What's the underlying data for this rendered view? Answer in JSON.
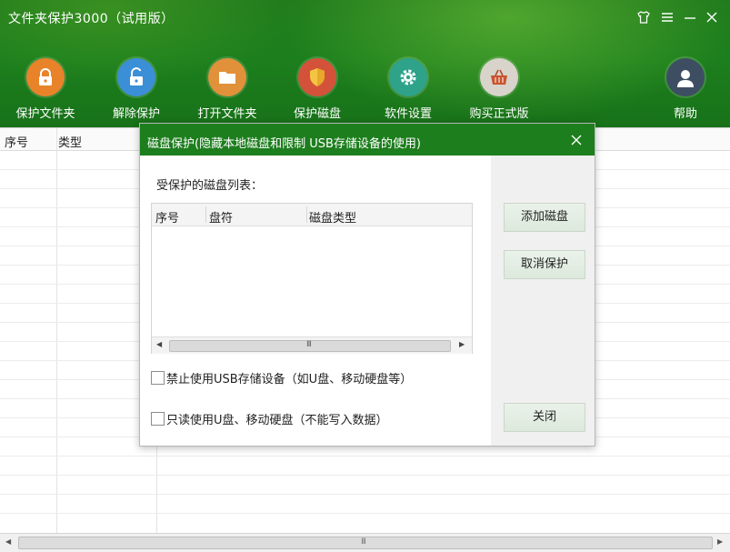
{
  "app": {
    "title": "文件夹保护3000（试用版）"
  },
  "window_controls": [
    {
      "name": "skin-icon"
    },
    {
      "name": "menu-icon"
    },
    {
      "name": "minimize-icon"
    },
    {
      "name": "close-icon"
    }
  ],
  "toolbar": {
    "items": [
      {
        "label": "保护文件夹",
        "icon": "lock-icon",
        "color": "#e8832a"
      },
      {
        "label": "解除保护",
        "icon": "unlock-icon",
        "color": "#3a8fd6"
      },
      {
        "label": "打开文件夹",
        "icon": "folder-icon",
        "color": "#e0913a"
      },
      {
        "label": "保护磁盘",
        "icon": "shield-icon",
        "color": "#d5523a"
      },
      {
        "label": "软件设置",
        "icon": "gear-icon",
        "color": "#2ea38a"
      },
      {
        "label": "购买正式版",
        "icon": "basket-icon",
        "color": "#d8d3cb"
      },
      {
        "label": "帮助",
        "icon": "user-icon",
        "color": "#3e4e62"
      }
    ]
  },
  "main_table": {
    "columns": [
      "序号",
      "类型"
    ]
  },
  "dialog": {
    "title": "磁盘保护(隐藏本地磁盘和限制 USB存储设备的使用)",
    "list_label": "受保护的磁盘列表：",
    "list_columns": [
      "序号",
      "盘符",
      "磁盘类型"
    ],
    "buttons": {
      "add": "添加磁盘",
      "cancel": "取消保护",
      "close": "关闭"
    },
    "options": {
      "usb_block": {
        "label": "禁止使用USB存储设备（如U盘、移动硬盘等）",
        "checked": false
      },
      "read_only": {
        "label": "只读使用U盘、移动硬盘（不能写入数据）",
        "checked": false
      }
    }
  },
  "scrollbar_grip": "III"
}
